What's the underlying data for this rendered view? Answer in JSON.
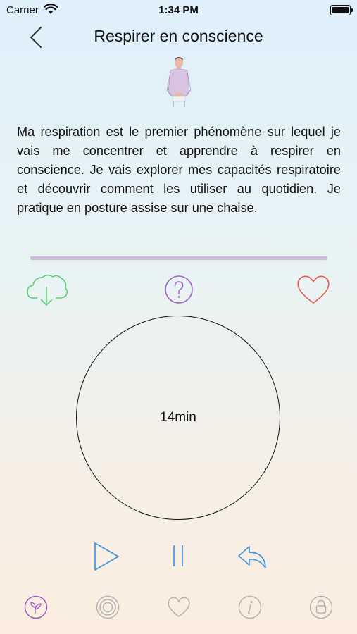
{
  "status_bar": {
    "carrier": "Carrier",
    "time": "1:34 PM"
  },
  "header": {
    "title": "Respirer en conscience"
  },
  "description": "Ma respiration est le premier phénomène sur lequel je vais me concentrer et apprendre à respirer en conscience. Je vais explorer mes capacités respiratoire et découvrir comment les utiliser au quotidien. Je pratique en posture assise sur une chaise.",
  "player": {
    "duration": "14min",
    "progress": 0
  },
  "icons": {
    "download": "cloud-download-icon",
    "help": "question-icon",
    "favorite": "heart-icon",
    "play": "play-icon",
    "pause": "pause-icon",
    "replay": "replay-icon"
  },
  "colors": {
    "download": "#5fce7a",
    "help": "#a463c8",
    "favorite": "#e8594f",
    "controls": "#3f95e0",
    "progress": "#cbbadb",
    "tab_active": "#9a5cc2",
    "tab_inactive": "#b0b0b0"
  },
  "tabs": [
    {
      "name": "sprout-icon",
      "active": true
    },
    {
      "name": "target-icon",
      "active": false
    },
    {
      "name": "heart-icon",
      "active": false
    },
    {
      "name": "info-icon",
      "active": false
    },
    {
      "name": "lock-icon",
      "active": false
    }
  ]
}
